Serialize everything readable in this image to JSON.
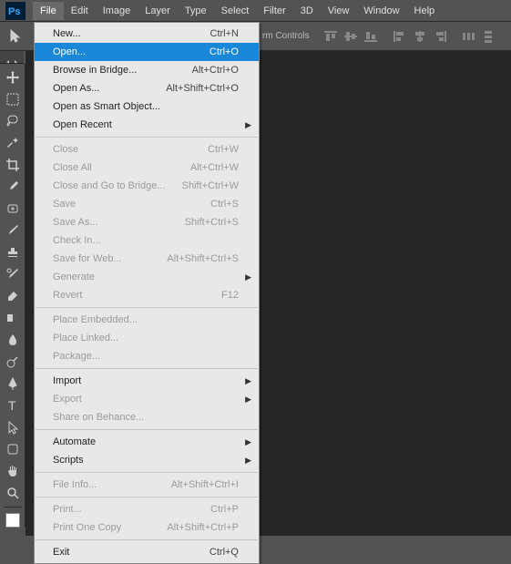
{
  "app": {
    "logo_text": "Ps"
  },
  "menubar": {
    "items": [
      {
        "label": "File",
        "active": true
      },
      {
        "label": "Edit",
        "active": false
      },
      {
        "label": "Image",
        "active": false
      },
      {
        "label": "Layer",
        "active": false
      },
      {
        "label": "Type",
        "active": false
      },
      {
        "label": "Select",
        "active": false
      },
      {
        "label": "Filter",
        "active": false
      },
      {
        "label": "3D",
        "active": false
      },
      {
        "label": "View",
        "active": false
      },
      {
        "label": "Window",
        "active": false
      },
      {
        "label": "Help",
        "active": false
      }
    ]
  },
  "optionsbar": {
    "extra_text": "rm Controls"
  },
  "file_menu": {
    "items": [
      {
        "label": "New...",
        "shortcut": "Ctrl+N",
        "type": "item"
      },
      {
        "label": "Open...",
        "shortcut": "Ctrl+O",
        "type": "item",
        "highlight": true
      },
      {
        "label": "Browse in Bridge...",
        "shortcut": "Alt+Ctrl+O",
        "type": "item"
      },
      {
        "label": "Open As...",
        "shortcut": "Alt+Shift+Ctrl+O",
        "type": "item"
      },
      {
        "label": "Open as Smart Object...",
        "shortcut": "",
        "type": "item"
      },
      {
        "label": "Open Recent",
        "shortcut": "",
        "type": "submenu"
      },
      {
        "type": "sep"
      },
      {
        "label": "Close",
        "shortcut": "Ctrl+W",
        "type": "item",
        "disabled": true
      },
      {
        "label": "Close All",
        "shortcut": "Alt+Ctrl+W",
        "type": "item",
        "disabled": true
      },
      {
        "label": "Close and Go to Bridge...",
        "shortcut": "Shift+Ctrl+W",
        "type": "item",
        "disabled": true
      },
      {
        "label": "Save",
        "shortcut": "Ctrl+S",
        "type": "item",
        "disabled": true
      },
      {
        "label": "Save As...",
        "shortcut": "Shift+Ctrl+S",
        "type": "item",
        "disabled": true
      },
      {
        "label": "Check In...",
        "shortcut": "",
        "type": "item",
        "disabled": true
      },
      {
        "label": "Save for Web...",
        "shortcut": "Alt+Shift+Ctrl+S",
        "type": "item",
        "disabled": true
      },
      {
        "label": "Generate",
        "shortcut": "",
        "type": "submenu",
        "disabled": true
      },
      {
        "label": "Revert",
        "shortcut": "F12",
        "type": "item",
        "disabled": true
      },
      {
        "type": "sep"
      },
      {
        "label": "Place Embedded...",
        "shortcut": "",
        "type": "item",
        "disabled": true
      },
      {
        "label": "Place Linked...",
        "shortcut": "",
        "type": "item",
        "disabled": true
      },
      {
        "label": "Package...",
        "shortcut": "",
        "type": "item",
        "disabled": true
      },
      {
        "type": "sep"
      },
      {
        "label": "Import",
        "shortcut": "",
        "type": "submenu"
      },
      {
        "label": "Export",
        "shortcut": "",
        "type": "submenu",
        "disabled": true
      },
      {
        "label": "Share on Behance...",
        "shortcut": "",
        "type": "item",
        "disabled": true
      },
      {
        "type": "sep"
      },
      {
        "label": "Automate",
        "shortcut": "",
        "type": "submenu"
      },
      {
        "label": "Scripts",
        "shortcut": "",
        "type": "submenu"
      },
      {
        "type": "sep"
      },
      {
        "label": "File Info...",
        "shortcut": "Alt+Shift+Ctrl+I",
        "type": "item",
        "disabled": true
      },
      {
        "type": "sep"
      },
      {
        "label": "Print...",
        "shortcut": "Ctrl+P",
        "type": "item",
        "disabled": true
      },
      {
        "label": "Print One Copy",
        "shortcut": "Alt+Shift+Ctrl+P",
        "type": "item",
        "disabled": true
      },
      {
        "type": "sep"
      },
      {
        "label": "Exit",
        "shortcut": "Ctrl+Q",
        "type": "item"
      }
    ]
  },
  "tools": [
    "move-tool",
    "marquee-tool",
    "lasso-tool",
    "magic-wand-tool",
    "crop-tool",
    "eyedropper-tool",
    "healing-brush-tool",
    "brush-tool",
    "stamp-tool",
    "history-brush-tool",
    "eraser-tool",
    "gradient-tool",
    "blur-tool",
    "dodge-tool",
    "pen-tool",
    "type-tool",
    "path-select-tool",
    "shape-tool",
    "hand-tool",
    "zoom-tool"
  ]
}
